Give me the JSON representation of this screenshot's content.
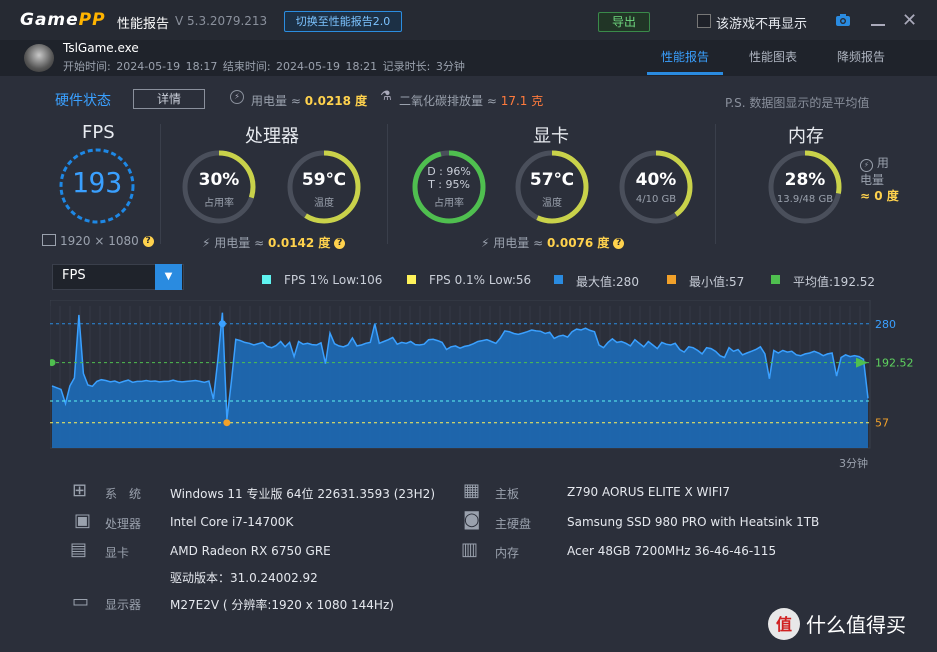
{
  "titlebar": {
    "logo_main": "Game",
    "logo_pp": "PP",
    "title": "性能报告",
    "version": "V 5.3.2079.213",
    "switch_button": "切换至性能报告2.0",
    "export_button": "导出",
    "hide_checkbox_label": "该游戏不再显示"
  },
  "game": {
    "name": "TslGame.exe",
    "times": "开始时间: 2024-05-19 18:17   结束时间: 2024-05-19 18:21   记录时长: 3分钟"
  },
  "tabs": [
    {
      "label": "性能报告",
      "active": true
    },
    {
      "label": "性能图表",
      "active": false
    },
    {
      "label": "降频报告",
      "active": false
    }
  ],
  "status": {
    "hw_status": "硬件状态",
    "detail_button": "详情",
    "power_label": "用电量 ≈ ",
    "power_value": "0.0218 度",
    "co2_label": "二氧化碳排放量 ≈ ",
    "co2_value": "17.1 克",
    "note": "P.S. 数据图显示的是平均值"
  },
  "fps": {
    "title": "FPS",
    "value": "193",
    "resolution": "1920 × 1080"
  },
  "cpu": {
    "title": "处理器",
    "usage_value": "30%",
    "usage_label": "占用率",
    "usage_pct": 30,
    "temp_value": "59℃",
    "temp_label": "温度",
    "temp_pct": 59,
    "power_label": "用电量 ≈ ",
    "power_value": "0.0142 度"
  },
  "gpu": {
    "title": "显卡",
    "d_line": "D : 96%",
    "t_line": "T : 95%",
    "usage_label": "占用率",
    "usage_pct": 96,
    "temp_value": "57℃",
    "temp_label": "温度",
    "temp_pct": 57,
    "vram_value": "40%",
    "vram_label": "4/10 GB",
    "vram_pct": 40,
    "power_label": "用电量 ≈ ",
    "power_value": "0.0076 度"
  },
  "mem": {
    "title": "内存",
    "value": "28%",
    "label": "13.9/48 GB",
    "pct": 28,
    "power_line1": "用",
    "power_line2": "电量",
    "power_value": "≈ 0 度"
  },
  "chart_panel": {
    "selector": "FPS",
    "legend": [
      {
        "label": "FPS 1% Low:106",
        "color": "#5ff3f0"
      },
      {
        "label": "FPS 0.1% Low:56",
        "color": "#fff35a"
      },
      {
        "label": "最大值:280",
        "color": "#2a8be0"
      },
      {
        "label": "最小值:57",
        "color": "#f2a12a"
      },
      {
        "label": "平均值:192.52",
        "color": "#4fbf4f"
      }
    ],
    "x_end_label": "3分钟"
  },
  "chart_data": {
    "type": "area",
    "series_label": "FPS",
    "ylim": [
      0,
      320
    ],
    "max": 280,
    "min": 57,
    "avg": 192.52,
    "low_1pct": 106,
    "low_01pct": 56,
    "ref_labels": [
      "280",
      "192.52",
      "57"
    ],
    "x_end": "3分钟",
    "values": [
      140,
      136,
      132,
      100,
      140,
      158,
      300,
      168,
      142,
      139,
      150,
      154,
      152,
      149,
      151,
      147,
      150,
      153,
      148,
      150,
      150,
      152,
      150,
      151,
      149,
      150,
      150,
      153,
      150,
      149,
      150,
      151,
      152,
      150,
      148,
      151,
      110,
      200,
      305,
      65,
      148,
      245,
      242,
      238,
      236,
      232,
      235,
      238,
      229,
      226,
      231,
      240,
      228,
      238,
      206,
      240,
      234,
      236,
      233,
      232,
      237,
      190,
      259,
      235,
      230,
      228,
      232,
      248,
      230,
      232,
      236,
      238,
      280,
      236,
      240,
      244,
      249,
      234,
      238,
      236,
      240,
      233,
      232,
      234,
      244,
      245,
      242,
      238,
      222,
      228,
      230,
      225,
      229,
      231,
      235,
      240,
      242,
      244,
      240,
      236,
      248,
      264,
      262,
      258,
      256,
      259,
      262,
      266,
      264,
      263,
      258,
      261,
      247,
      252,
      254,
      250,
      262,
      268,
      266,
      270,
      265,
      262,
      232,
      226,
      238,
      246,
      238,
      240,
      236,
      230,
      244,
      236,
      228,
      240,
      232,
      224,
      238,
      234,
      232,
      236,
      222,
      216,
      228,
      226,
      220,
      212,
      226,
      224,
      218,
      208,
      204,
      226,
      218,
      222,
      210,
      214,
      218,
      222,
      228,
      212,
      156,
      220,
      214,
      220,
      216,
      218,
      210,
      208,
      212,
      214,
      218,
      214,
      208,
      212,
      214,
      162,
      204,
      210,
      206,
      208,
      206,
      200,
      112
    ]
  },
  "system_info": [
    {
      "icon": "windows-icon",
      "key": "系　统",
      "value": "Windows 11 专业版 64位 22631.3593 (23H2)"
    },
    {
      "icon": "cpu-icon",
      "key": "处理器",
      "value": "Intel Core i7-14700K"
    },
    {
      "icon": "gpu-icon",
      "key": "显卡",
      "value": "AMD Radeon RX 6750 GRE"
    },
    {
      "icon": "",
      "key": "",
      "value": "驱动版本：31.0.24002.92"
    },
    {
      "icon": "monitor-icon",
      "key": "显示器",
      "value": "M27E2V ( 分辨率:1920 x 1080 144Hz)"
    },
    {
      "icon": "motherboard-icon",
      "key": "主板",
      "value": "Z790 AORUS ELITE X WIFI7"
    },
    {
      "icon": "disk-icon",
      "key": "主硬盘",
      "value": "Samsung SSD 980 PRO with Heatsink 1TB"
    },
    {
      "icon": "memory-icon",
      "key": "内存",
      "value": "Acer 48GB 7200MHz 36-46-46-115"
    }
  ],
  "watermark": "值 什么值得买",
  "colors": {
    "accent": "#2a8be0",
    "gauge_arc": "#c9d24a",
    "gpu_arc": "#4fbf4f",
    "fps_ring": "#1e88e5"
  }
}
